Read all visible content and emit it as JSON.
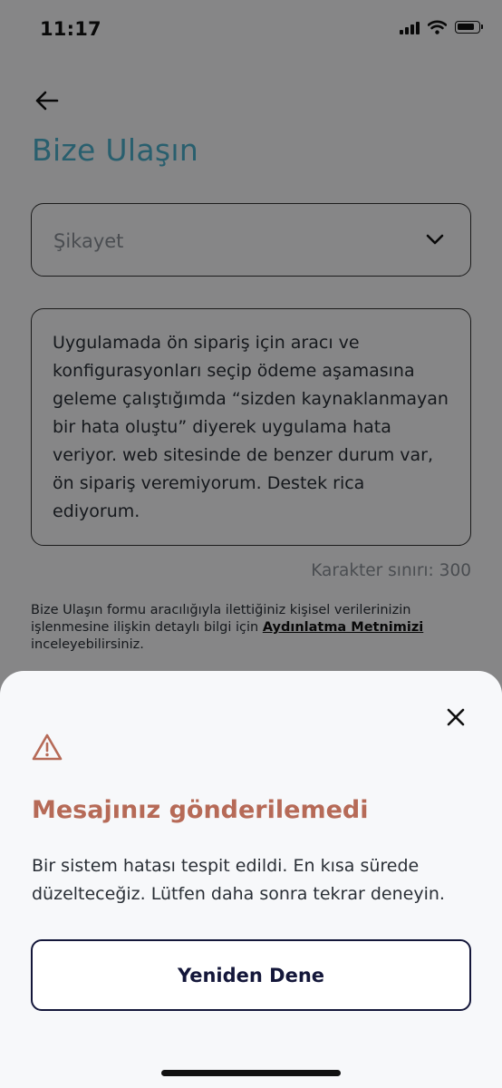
{
  "status_bar": {
    "time": "11:17"
  },
  "page": {
    "title": "Bize Ulaşın",
    "subject_select": {
      "value": "Şikayet"
    },
    "message": {
      "value": "Uygulamada ön sipariş için aracı ve konfigurasyonları seçip ödeme aşamasına geleme çalıştığımda “sizden kaynaklanmayan bir hata oluştu” diyerek uygulama hata veriyor. web sitesinde de benzer durum var, ön sipariş veremiyorum. Destek rica ediyorum."
    },
    "char_limit": "Karakter sınırı: 300",
    "kvkk": {
      "before": "Bize Ulaşın formu aracılığıyla ilettiğiniz kişisel verilerinizin işlenmesine ilişkin detaylı bilgi için ",
      "link": "Aydınlatma Metnimizi",
      "after": " inceleyebilirsiniz."
    }
  },
  "sheet": {
    "title": "Mesajınız gönderilemedi",
    "body": "Bir sistem hatası tespit edildi. En kısa sürede düzelteceğiz. Lütfen daha sonra tekrar deneyin.",
    "retry_label": "Yeniden Dene"
  },
  "icons": {
    "back": "arrow-left-icon",
    "select": "chevron-down-icon",
    "close": "close-icon",
    "warning": "warning-triangle-icon"
  },
  "colors": {
    "title": "#4db0cc",
    "error_title": "#b66a57",
    "primary": "#14173a"
  }
}
